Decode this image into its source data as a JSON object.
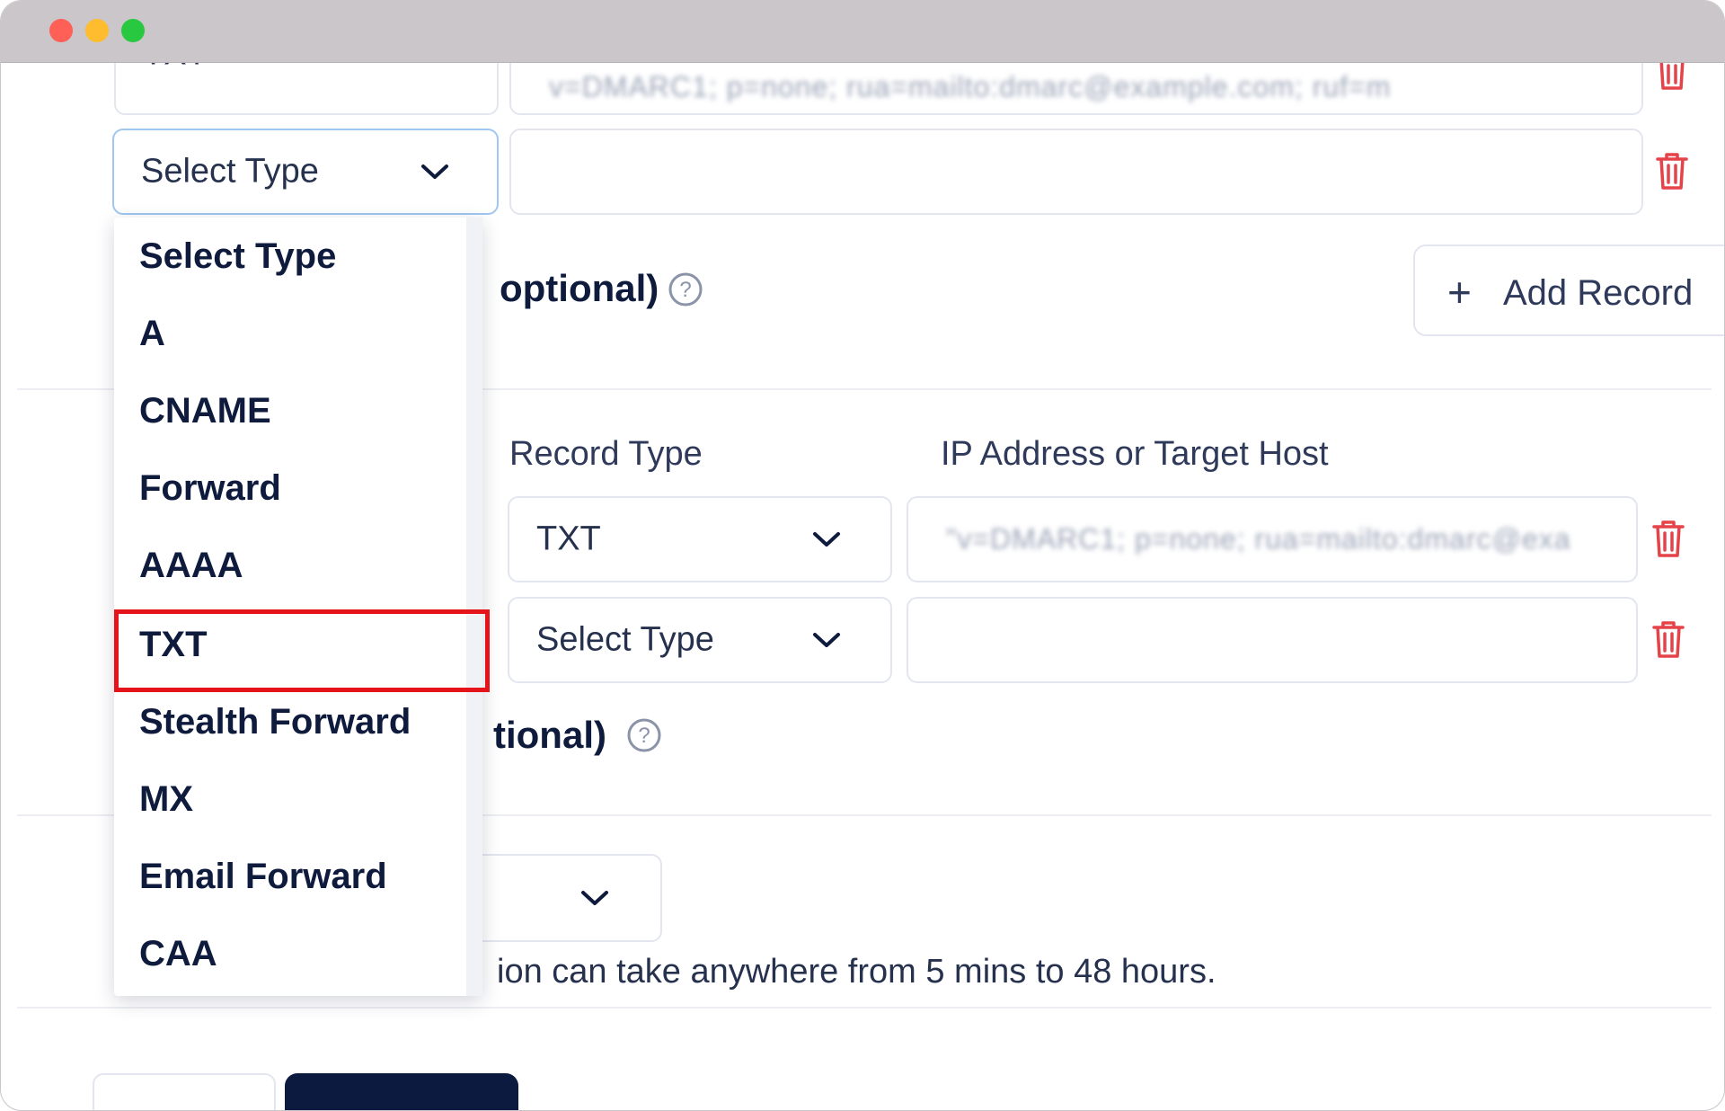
{
  "window": {
    "controls": [
      "close",
      "minimize",
      "maximize"
    ]
  },
  "section1": {
    "row1": {
      "type": "TXT",
      "value": "v=DMARC1; p=none; rua=mailto:dmarc@example.com; ruf=m"
    },
    "row2": {
      "type": "Select Type",
      "value": ""
    },
    "optional_label": "optional)",
    "add_record_label": "Add Record"
  },
  "section2": {
    "record_type_header": "Record Type",
    "target_header": "IP Address or Target Host",
    "row1": {
      "type": "TXT",
      "value": "\"v=DMARC1; p=none; rua=mailto:dmarc@exa"
    },
    "row2": {
      "type": "Select Type",
      "value": ""
    },
    "optional_label": "tional)"
  },
  "section3": {
    "note": "ion can take anywhere from 5 mins to 48 hours."
  },
  "dropdown": {
    "options": [
      "Select Type",
      "A",
      "CNAME",
      "Forward",
      "AAAA",
      "TXT",
      "Stealth Forward",
      "MX",
      "Email Forward",
      "CAA"
    ],
    "highlighted": "TXT"
  },
  "colors": {
    "highlight": "#e5141b",
    "trash": "#e5434a",
    "primary_button": "#0c1a3f",
    "focus_border": "#9fc7f0"
  }
}
